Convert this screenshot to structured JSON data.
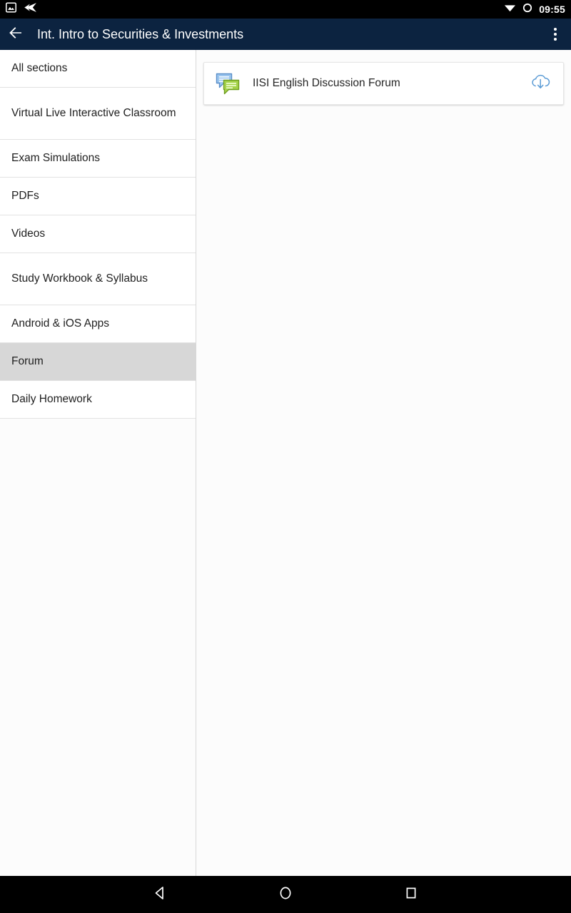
{
  "status_bar": {
    "icons_left": [
      "image-icon",
      "rewind-arrow-icon"
    ],
    "icons_right": [
      "wifi-icon",
      "battery-ring-icon"
    ],
    "time": "09:55",
    "background_color": "#000000"
  },
  "app_bar": {
    "back_icon": "back-arrow-icon",
    "title": "Int. Intro to Securities & Investments",
    "overflow_icon": "more-vert-icon",
    "background_color": "#0c2340",
    "text_color": "#ffffff"
  },
  "sidebar": {
    "selected_index": 7,
    "selected_color": "#d7d7d7",
    "items": [
      {
        "label": "All sections",
        "lines": 1
      },
      {
        "label": "Virtual Live Interactive Classroom",
        "lines": 2
      },
      {
        "label": "Exam Simulations",
        "lines": 1
      },
      {
        "label": "PDFs",
        "lines": 1
      },
      {
        "label": "Videos",
        "lines": 1
      },
      {
        "label": "Study Workbook & Syllabus",
        "lines": 2
      },
      {
        "label": "Android & iOS Apps",
        "lines": 1
      },
      {
        "label": "Forum",
        "lines": 1
      },
      {
        "label": "Daily Homework",
        "lines": 1
      }
    ]
  },
  "main": {
    "cards": [
      {
        "icon": "forum-bubbles-icon",
        "title": "IISI English Discussion Forum",
        "action_icon": "cloud-download-icon",
        "action_color": "#5b9bd5"
      }
    ]
  },
  "nav_bar": {
    "buttons": [
      {
        "name": "back-nav-button",
        "icon": "triangle-back-icon"
      },
      {
        "name": "home-nav-button",
        "icon": "circle-home-icon"
      },
      {
        "name": "recents-nav-button",
        "icon": "square-recents-icon"
      }
    ],
    "background_color": "#000000"
  }
}
